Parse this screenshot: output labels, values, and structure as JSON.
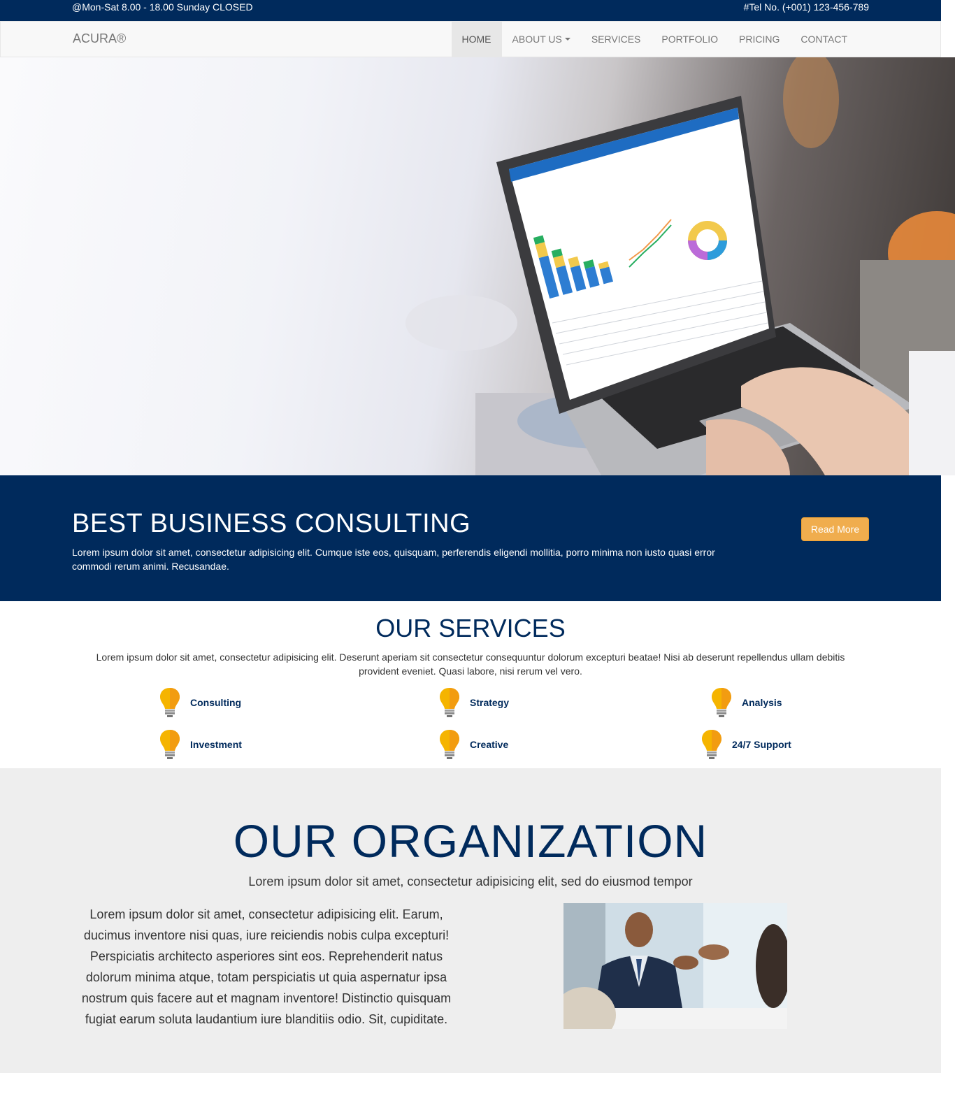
{
  "topbar": {
    "hours": "@Mon-Sat 8.00 - 18.00 Sunday CLOSED",
    "tel": "#Tel No. (+001) 123-456-789"
  },
  "navbar": {
    "brand": "ACURA®",
    "items": [
      {
        "label": "HOME",
        "active": true
      },
      {
        "label": "ABOUT US",
        "dropdown": true
      },
      {
        "label": "SERVICES"
      },
      {
        "label": "PORTFOLIO"
      },
      {
        "label": "PRICING"
      },
      {
        "label": "CONTACT"
      }
    ]
  },
  "hero": {
    "image": "laptop-dashboard-photo"
  },
  "banner": {
    "title": "BEST BUSINESS CONSULTING",
    "text": "Lorem ipsum dolor sit amet, consectetur adipisicing elit. Cumque iste eos, quisquam, perferendis eligendi mollitia, porro minima non iusto quasi error commodi rerum animi. Recusandae.",
    "button": "Read More"
  },
  "services": {
    "title": "OUR SERVICES",
    "description": "Lorem ipsum dolor sit amet, consectetur adipisicing elit. Deserunt aperiam sit consectetur consequuntur dolorum excepturi beatae! Nisi ab deserunt repellendus ullam debitis provident eveniet. Quasi labore, nisi rerum vel vero.",
    "icon": "lightbulb-icon",
    "items": [
      "Consulting",
      "Strategy",
      "Analysis",
      "Investment",
      "Creative",
      "24/7 Support"
    ]
  },
  "organization": {
    "title": "OUR ORGANIZATION",
    "subtitle": "Lorem ipsum dolor sit amet, consectetur adipisicing elit, sed do eiusmod tempor",
    "body": "Lorem ipsum dolor sit amet, consectetur adipisicing elit. Earum, ducimus inventore nisi quas, iure reiciendis nobis culpa excepturi! Perspiciatis architecto asperiores sint eos. Reprehenderit natus dolorum minima atque, totam perspiciatis ut quia aspernatur ipsa nostrum quis facere aut et magnam inventore! Distinctio quisquam fugiat earum soluta laudantium iure blanditiis odio. Sit, cupiditate.",
    "image": "business-meeting-photo"
  },
  "colors": {
    "brand_navy": "#002a5c",
    "accent_orange": "#f0ad4e",
    "bulb_yellow": "#f5b400"
  }
}
